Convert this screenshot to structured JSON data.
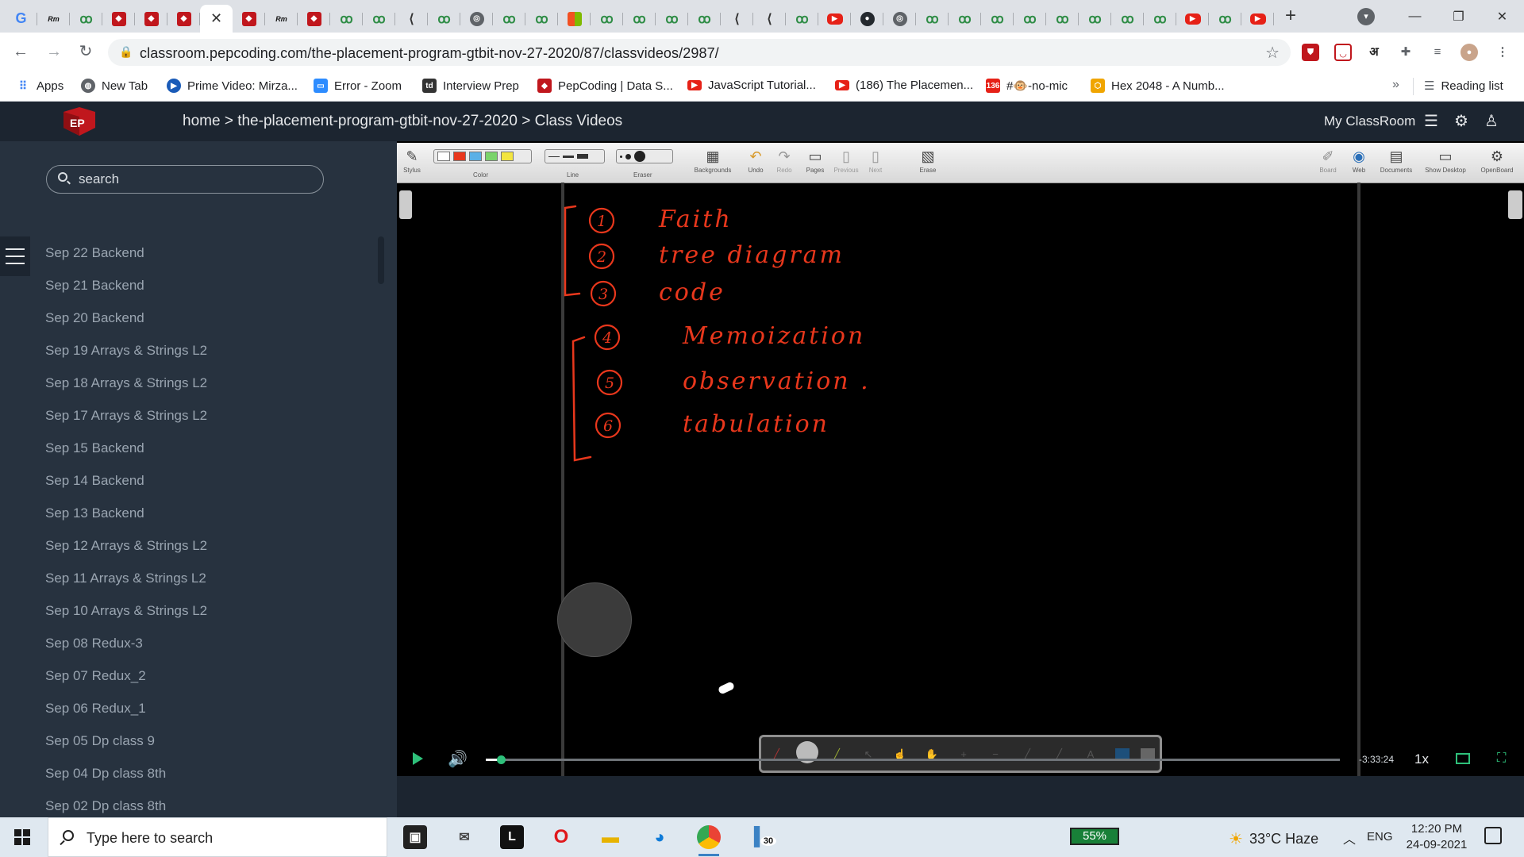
{
  "browser": {
    "tabs": [
      "G",
      "Rm",
      "oo",
      "pep",
      "pep",
      "pep",
      "x",
      "pep",
      "Rm",
      "pep",
      "oo",
      "oo",
      "lc",
      "oo",
      "@",
      "oo",
      "oo",
      "ms",
      "oo",
      "oo",
      "oo",
      "oo",
      "lc",
      "lc",
      "oo",
      "yt",
      "gh",
      "@",
      "oo",
      "oo",
      "oo",
      "oo",
      "oo",
      "oo",
      "oo",
      "oo",
      "yt",
      "oo",
      "yt"
    ],
    "new_tab": "+",
    "url": "classroom.pepcoding.com/the-placement-program-gtbit-nov-27-2020/87/classvideos/2987/",
    "bookmarks": [
      {
        "label": "Apps",
        "icon": "apps-icon"
      },
      {
        "label": "New Tab",
        "icon": "globe-icon"
      },
      {
        "label": "Prime Video: Mirza...",
        "icon": "prime-video-icon"
      },
      {
        "label": "Error - Zoom",
        "icon": "zoom-icon"
      },
      {
        "label": "Interview Prep",
        "icon": "td-icon"
      },
      {
        "label": "PepCoding | Data S...",
        "icon": "pepcoding-icon"
      },
      {
        "label": "JavaScript Tutorial...",
        "icon": "youtube-icon"
      },
      {
        "label": "(186) The Placemen...",
        "icon": "youtube-icon"
      },
      {
        "label": "#🐵-no-mic",
        "icon": "discord-icon"
      },
      {
        "label": "Hex 2048 - A Numb...",
        "icon": "hex-icon"
      }
    ],
    "bookmarks_more": "»",
    "reading_list": "Reading list"
  },
  "site": {
    "breadcrumb": [
      "home",
      "the-placement-program-gtbit-nov-27-2020",
      "Class Videos"
    ],
    "breadcrumb_sep": ">",
    "my_classroom": "My ClassRoom",
    "search_placeholder": "search"
  },
  "lectures": [
    "Sep 22 Backend",
    "Sep 21 Backend",
    "Sep 20 Backend",
    "Sep 19 Arrays & Strings L2",
    "Sep 18 Arrays & Strings L2",
    "Sep 17 Arrays & Strings L2",
    "Sep 15 Backend",
    "Sep 14 Backend",
    "Sep 13 Backend",
    "Sep 12 Arrays & Strings L2",
    "Sep 11 Arrays & Strings L2",
    "Sep 10 Arrays & Strings L2",
    "Sep 08 Redux-3",
    "Sep 07 Redux_2",
    "Sep 06 Redux_1",
    "Sep 05 Dp class 9",
    "Sep 04 Dp class 8th",
    "Sep 02 Dp class 8th"
  ],
  "board_toolbar": {
    "stylus": "Stylus",
    "color": "Color",
    "line": "Line",
    "eraser": "Eraser",
    "backgrounds": "Backgrounds",
    "undo": "Undo",
    "redo": "Redo",
    "pages": "Pages",
    "previous": "Previous",
    "next": "Next",
    "erase": "Erase",
    "board": "Board",
    "web": "Web",
    "documents": "Documents",
    "show_desktop": "Show Desktop",
    "openboard": "OpenBoard"
  },
  "handwriting": {
    "group1": [
      {
        "num": "1",
        "text": "Faith"
      },
      {
        "num": "2",
        "text": "tree diagram"
      },
      {
        "num": "3",
        "text": "code"
      }
    ],
    "group2": [
      {
        "num": "4",
        "text": "Memoization"
      },
      {
        "num": "5",
        "text": "observation ."
      },
      {
        "num": "6",
        "text": "tabulation"
      }
    ],
    "ink_color": "#e8371c"
  },
  "player": {
    "time_remaining": "-3:33:24",
    "speed": "1x",
    "progress": 0.018
  },
  "taskbar": {
    "search_placeholder": "Type here to search",
    "battery": "55%",
    "weather": "33°C  Haze",
    "language": "ENG",
    "time": "12:20 PM",
    "date": "24-09-2021",
    "badge": "30"
  },
  "colors": {
    "header_bg": "#1c2530",
    "sidebar_bg": "#27323f",
    "accent_green": "#2ec07a",
    "brand_red": "#c0171d"
  }
}
